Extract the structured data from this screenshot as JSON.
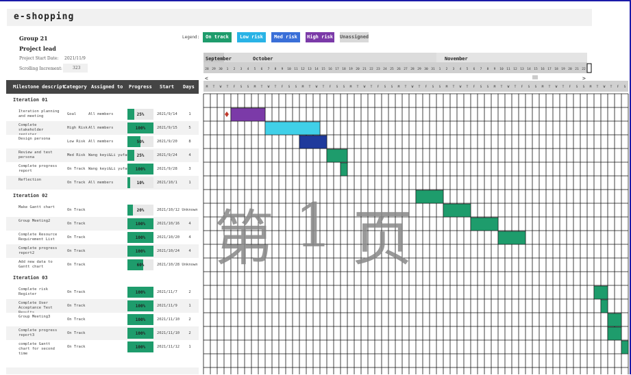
{
  "app": {
    "title": "e-shopping"
  },
  "project": {
    "group": "Group 21",
    "role": "Project lead",
    "start_label": "Project Start Date:",
    "start_value": "2021/11/9",
    "scroll_label": "Scrolling Increment:",
    "scroll_value": "323"
  },
  "legend": {
    "label": "Legend:",
    "items": [
      {
        "text": "On track",
        "color": "#1e9c6c"
      },
      {
        "text": "Low risk",
        "color": "#29b3e6"
      },
      {
        "text": "Med risk",
        "color": "#3a6fd8"
      },
      {
        "text": "High risk",
        "color": "#7b3aa8"
      },
      {
        "text": "Unassigned",
        "color": "#d9d9d9"
      }
    ]
  },
  "table": {
    "headers": [
      "Milestone descript",
      "Category",
      "Assigned to",
      "Progress",
      "Start",
      "Days"
    ],
    "groups": [
      {
        "name": "Iteration 01",
        "tasks": [
          {
            "desc": "Iteration planning and meeting",
            "cat": "Goal",
            "assigned": "All members",
            "progress": "25%",
            "pct": 25,
            "start": "2021/9/14",
            "days": "1"
          },
          {
            "desc": "Complete stakeholder register",
            "cat": "High Risk",
            "assigned": "All members",
            "progress": "100%",
            "pct": 100,
            "start": "2021/9/15",
            "days": "5"
          },
          {
            "desc": "Design persona",
            "cat": "Low Risk",
            "assigned": "All members",
            "progress": "50%",
            "pct": 50,
            "start": "2021/9/20",
            "days": "8"
          },
          {
            "desc": "Review and test persona",
            "cat": "Med Risk",
            "assigned": "Wang keyi&Li yufan",
            "progress": "25%",
            "pct": 25,
            "start": "2021/9/24",
            "days": "4"
          },
          {
            "desc": "Complete progress report",
            "cat": "On Track",
            "assigned": "Wang keyi&Li yufan",
            "progress": "100%",
            "pct": 100,
            "start": "2021/9/28",
            "days": "3"
          },
          {
            "desc": "Reflection",
            "cat": "On Track",
            "assigned": "All members",
            "progress": "10%",
            "pct": 10,
            "start": "2021/10/1",
            "days": "1"
          }
        ]
      },
      {
        "name": "Iteration 02",
        "tasks": [
          {
            "desc": "Make Gantt chart",
            "cat": "On Track",
            "assigned": "",
            "progress": "20%",
            "pct": 20,
            "start": "2021/10/12",
            "days": "Unknown"
          },
          {
            "desc": "Group Meeting2",
            "cat": "On Track",
            "assigned": "",
            "progress": "100%",
            "pct": 100,
            "start": "2021/10/16",
            "days": "4"
          },
          {
            "desc": "Complete Resource Requirement List",
            "cat": "On Track",
            "assigned": "",
            "progress": "100%",
            "pct": 100,
            "start": "2021/10/20",
            "days": "4"
          },
          {
            "desc": "Complete progress report2",
            "cat": "On Track",
            "assigned": "",
            "progress": "100%",
            "pct": 100,
            "start": "2021/10/24",
            "days": "4"
          },
          {
            "desc": "Add new data to Gantt chart",
            "cat": "On Track",
            "assigned": "",
            "progress": "60%",
            "pct": 60,
            "start": "2021/10/28",
            "days": "Unknown"
          }
        ]
      },
      {
        "name": "Iteration 03",
        "tasks": [
          {
            "desc": "Complete risk Register",
            "cat": "On Track",
            "assigned": "",
            "progress": "100%",
            "pct": 100,
            "start": "2021/11/7",
            "days": "2"
          },
          {
            "desc": "Complete User Acceptance Test Results",
            "cat": "On Track",
            "assigned": "",
            "progress": "100%",
            "pct": 100,
            "start": "2021/11/9",
            "days": "1"
          },
          {
            "desc": "Group Meeting3",
            "cat": "On Track",
            "assigned": "",
            "progress": "100%",
            "pct": 100,
            "start": "2021/11/10",
            "days": "2"
          },
          {
            "desc": "Complete progress report3",
            "cat": "On Track",
            "assigned": "",
            "progress": "100%",
            "pct": 100,
            "start": "2021/11/10",
            "days": "2"
          },
          {
            "desc": "complete Gantt chart for second time",
            "cat": "On Track",
            "assigned": "",
            "progress": "100%",
            "pct": 100,
            "start": "2021/11/12",
            "days": "1"
          }
        ]
      }
    ]
  },
  "timeline": {
    "months": [
      "September",
      "October",
      "November"
    ],
    "day_numbers": [
      "28",
      "29",
      "30",
      "1",
      "2",
      "3",
      "4",
      "5",
      "6",
      "7",
      "8",
      "9",
      "10",
      "11",
      "12",
      "13",
      "14",
      "15",
      "16",
      "17",
      "18",
      "19",
      "20",
      "21",
      "22",
      "23",
      "24",
      "25",
      "26",
      "27",
      "28",
      "29",
      "30",
      "31",
      "1",
      "2",
      "3",
      "4",
      "5",
      "6",
      "7",
      "8",
      "9",
      "10",
      "11",
      "12",
      "13",
      "14",
      "15",
      "16",
      "17",
      "18",
      "19",
      "20",
      "21",
      "22"
    ],
    "weekday_letters": [
      "M",
      "T",
      "W",
      "T",
      "F",
      "S",
      "S"
    ],
    "watermark": [
      "第",
      "1",
      "页"
    ],
    "colors": {
      "on_track": "#1e9c6c",
      "low": "#40d0e8",
      "med": "#1f3a9c",
      "high": "#7b3aa8",
      "milestone": "#c0392b"
    }
  }
}
